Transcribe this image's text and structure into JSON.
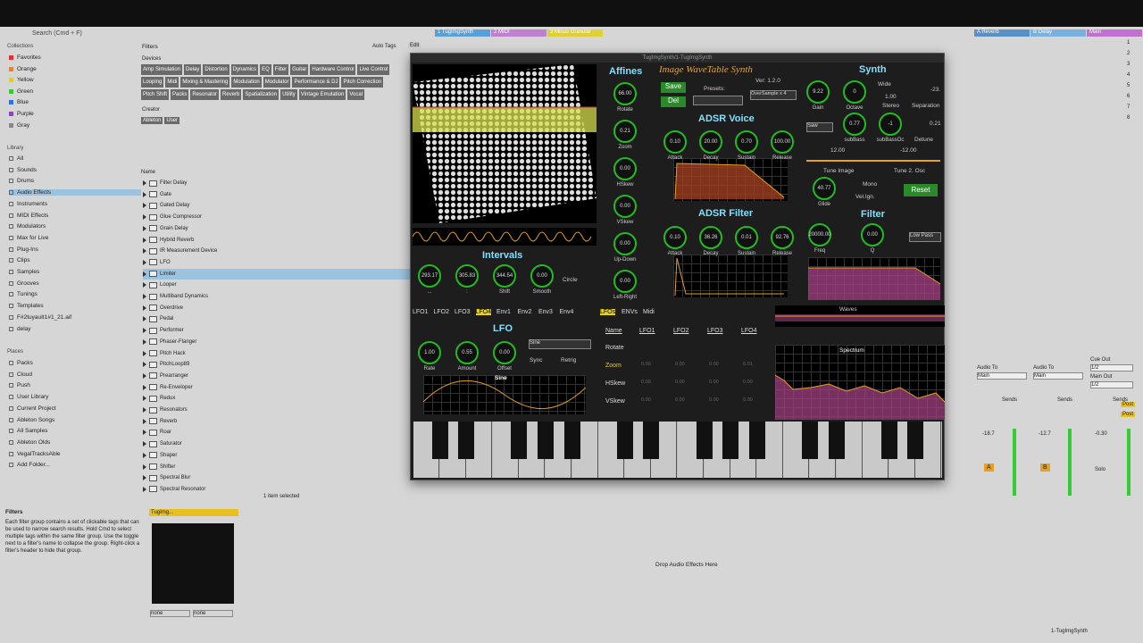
{
  "browser": {
    "search_placeholder": "Search (Cmd + F)",
    "collections_label": "Collections",
    "collections": [
      {
        "label": "Favorites",
        "color": "#e03030"
      },
      {
        "label": "Orange",
        "color": "#f08020"
      },
      {
        "label": "Yellow",
        "color": "#e0d020"
      },
      {
        "label": "Green",
        "color": "#40c040"
      },
      {
        "label": "Blue",
        "color": "#3070e0"
      },
      {
        "label": "Purple",
        "color": "#9040d0"
      },
      {
        "label": "Gray",
        "color": "#888888"
      }
    ],
    "library_label": "Library",
    "library": [
      "All",
      "Sounds",
      "Drums",
      "Audio Effects",
      "Instruments",
      "MIDI Effects",
      "Modulators",
      "Max for Live",
      "Plug-Ins",
      "Clips",
      "Samples",
      "Grooves",
      "Tunings",
      "Templates",
      "F#2tuyauIt1#1_21.aif",
      "delay"
    ],
    "places_label": "Places",
    "places": [
      "Packs",
      "Cloud",
      "Push",
      "User Library",
      "Current Project",
      "Ableton Songs",
      "All Samples",
      "Ableton Olds",
      "VegalTracksAble",
      "Add Folder..."
    ],
    "filters_label": "Filters",
    "auto_tags": "Auto Tags",
    "edit": "Edit",
    "devices_label": "Devices",
    "tags": [
      "Amp Simulation",
      "Delay",
      "Distortion",
      "Dynamics",
      "EQ",
      "Filter",
      "Guitar",
      "Hardware Control",
      "Live Control",
      "Looping",
      "Midi",
      "Mixing & Mastering",
      "Modulation",
      "Modulator",
      "Performance & DJ",
      "Pitch Correction",
      "Pitch Shift",
      "Packs",
      "Resonator",
      "Reverb",
      "Spatialization",
      "Utility",
      "Vintage Emulation",
      "Vocal"
    ],
    "creator_label": "Creator",
    "creators": [
      "Ableton",
      "User"
    ],
    "name_header": "Name",
    "items": [
      "Filter Delay",
      "Gate",
      "Gated Delay",
      "Glue Compressor",
      "Grain Delay",
      "Hybrid Reverb",
      "IR Measurement Device",
      "LFO",
      "Limiter",
      "Looper",
      "Multiband Dynamics",
      "Overdrive",
      "Pedal",
      "Performer",
      "Phaser-Flanger",
      "Pitch Hack",
      "PitchLoop89",
      "Prearranger",
      "Re-Enveloper",
      "Redux",
      "Resonators",
      "Reverb",
      "Roar",
      "Saturator",
      "Shaper",
      "Shifter",
      "Spectral Blur",
      "Spectral Resonator"
    ],
    "status": "1 item selected",
    "info_title": "Filters",
    "info_text": "Each filter group contains a set of clickable tags that can be used to narrow search results. Hold Cmd to select multiple tags within the same filter group. Use the toggle next to a filter's name to collapse the group. Right-click a filter's header to hide that group."
  },
  "tracks": [
    {
      "label": "1 TugImgSynth",
      "color": "#5aa0d8"
    },
    {
      "label": "2 MIDI",
      "color": "#c080d0"
    },
    {
      "label": "3 Minus Granular",
      "color": "#e0d030"
    }
  ],
  "returns": [
    {
      "label": "A Reverb",
      "color": "#5a90c8"
    },
    {
      "label": "B Delay",
      "color": "#7ab0e0"
    },
    {
      "label": "Main",
      "color": "#c070d0"
    }
  ],
  "scene_numbers": [
    "1",
    "2",
    "3",
    "4",
    "5",
    "6",
    "7",
    "8"
  ],
  "plugin": {
    "window_title": "TugImgSynth/1-TugImgSynth",
    "affines": "Affines",
    "synth_title": "Image WaveTable Synth",
    "version": "Ver: 1.2.0",
    "save": "Save",
    "del": "Del",
    "presets": "Presets:",
    "oversample": "OverSample x 4",
    "affine_knobs": [
      {
        "value": "66.00",
        "label": "Rotate"
      },
      {
        "value": "0.21",
        "label": "Zoom"
      },
      {
        "value": "0.00",
        "label": "HSkew"
      },
      {
        "value": "0.00",
        "label": "VSkew"
      },
      {
        "value": "0.00",
        "label": "Up-Down"
      },
      {
        "value": "0.00",
        "label": "Left-Right"
      }
    ],
    "intervals": "Intervals",
    "interval_knobs": [
      {
        "value": "293.17",
        "label": "..."
      },
      {
        "value": "305.83",
        "label": ":"
      },
      {
        "value": "344.54",
        "label": "Shift"
      },
      {
        "value": "0.00",
        "label": "Smooth"
      }
    ],
    "circle": "Circle",
    "adsr_voice": "ADSR Voice",
    "voice_knobs": [
      {
        "value": "0.10",
        "label": "Attack"
      },
      {
        "value": "20.00",
        "label": "Decay"
      },
      {
        "value": "0.70",
        "label": "Sustain"
      },
      {
        "value": "100.00",
        "label": "Release"
      }
    ],
    "adsr_filter": "ADSR Filter",
    "filter_knobs": [
      {
        "value": "0.10",
        "label": "Attack"
      },
      {
        "value": "36.26",
        "label": "Decay"
      },
      {
        "value": "0.01",
        "label": "Sustain"
      },
      {
        "value": "92.76",
        "label": "Release"
      }
    ],
    "synth": "Synth",
    "gain": {
      "value": "9.22",
      "label": "Gain"
    },
    "octave": {
      "value": "0",
      "label": "Octave"
    },
    "wide": "Wide",
    "stereo": "Stereo",
    "separation": "Separation",
    "sep_value": "-23.",
    "stereo_value": "1.00",
    "saw": "Saw",
    "subbass": {
      "value": "0.77",
      "label": "subBass"
    },
    "subbassoc": {
      "value": "-1",
      "label": "subBassOc"
    },
    "detune": "Detune",
    "detune_value": "0.21",
    "tune_image_value": "12.00",
    "tune2_value": "-12.00",
    "tune_image": "Tune Image",
    "tune2": "Tune 2. Osc",
    "glide": {
      "value": "40.77",
      "label": "Glide"
    },
    "mono": "Mono",
    "velign": "Vel.Ign.",
    "reset": "Reset",
    "filter": "Filter",
    "freq": {
      "value": "20000.00",
      "label": "Freq"
    },
    "q": {
      "value": "0.00",
      "label": "Q"
    },
    "lowpass": "Low Pass",
    "lfo_tabs": [
      "LFO1",
      "LFO2",
      "LFO3",
      "LFO4",
      "Env1",
      "Env2",
      "Env3",
      "Env4"
    ],
    "lfo_title": "LFO",
    "sine_select": "Sine",
    "lfo_knobs": [
      {
        "value": "1.00",
        "label": "Rate"
      },
      {
        "value": "0.55",
        "label": "Amount"
      },
      {
        "value": "0.00",
        "label": "Offset"
      }
    ],
    "sync": "Sync",
    "retrig": "Retrig",
    "wave_label": "Sine",
    "mod_tabs": [
      "LFOs",
      "ENVs",
      "Midi"
    ],
    "mod_cols": [
      "Name",
      "LFO1",
      "LFO2",
      "LFO3",
      "LFO4"
    ],
    "mod_rows": [
      {
        "name": "Rotate",
        "vals": [
          "",
          "",
          "",
          ""
        ]
      },
      {
        "name": "Zoom",
        "vals": [
          "0.00",
          "0.00",
          "0.00",
          "0.01"
        ]
      },
      {
        "name": "HSkew",
        "vals": [
          "0.00",
          "0.00",
          "0.00",
          "0.00"
        ]
      },
      {
        "name": "VSkew",
        "vals": [
          "0.00",
          "0.00",
          "0.00",
          "0.00"
        ]
      }
    ],
    "waves": "Waves",
    "spectrum": "Spectrum"
  },
  "mixer": {
    "audio_to": "Audio To",
    "main": "Main",
    "sends": "Sends",
    "cue_out": "Cue Out",
    "cue_val": "1/2",
    "main_out": "Main Out",
    "main_val": "1/2",
    "vol1": "-18.7",
    "vol2": "-12.7",
    "vol3": "-0.30",
    "a": "A",
    "b": "B",
    "solo": "Solo",
    "post": "Post"
  },
  "detail": {
    "device": "TugImg...",
    "none1": "none",
    "none2": "none",
    "drop": "Drop Audio Effects Here",
    "bottom_track": "1-TugImgSynth"
  }
}
